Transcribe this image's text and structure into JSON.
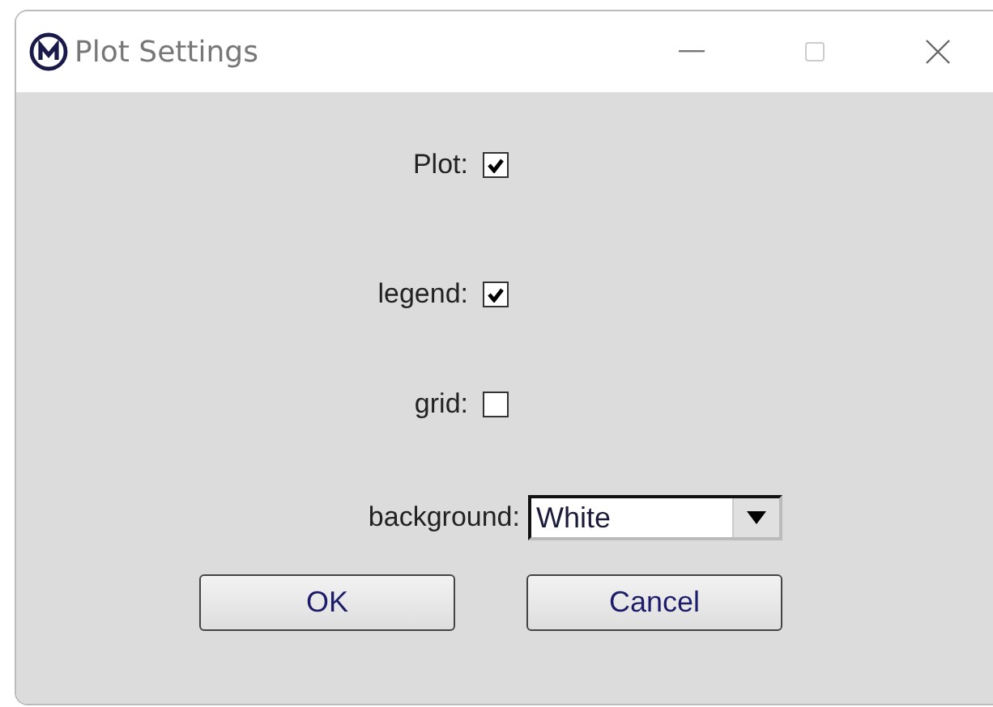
{
  "window": {
    "title": "Plot Settings"
  },
  "options": [
    {
      "kind": "checkbox",
      "label": "Plot:",
      "checked": true
    },
    {
      "kind": "checkbox",
      "label": "legend:",
      "checked": true
    },
    {
      "kind": "checkbox",
      "label": "grid:",
      "checked": false
    },
    {
      "kind": "dropdown",
      "label": "background:",
      "value": "White"
    }
  ],
  "buttons": [
    "OK",
    "Cancel"
  ]
}
